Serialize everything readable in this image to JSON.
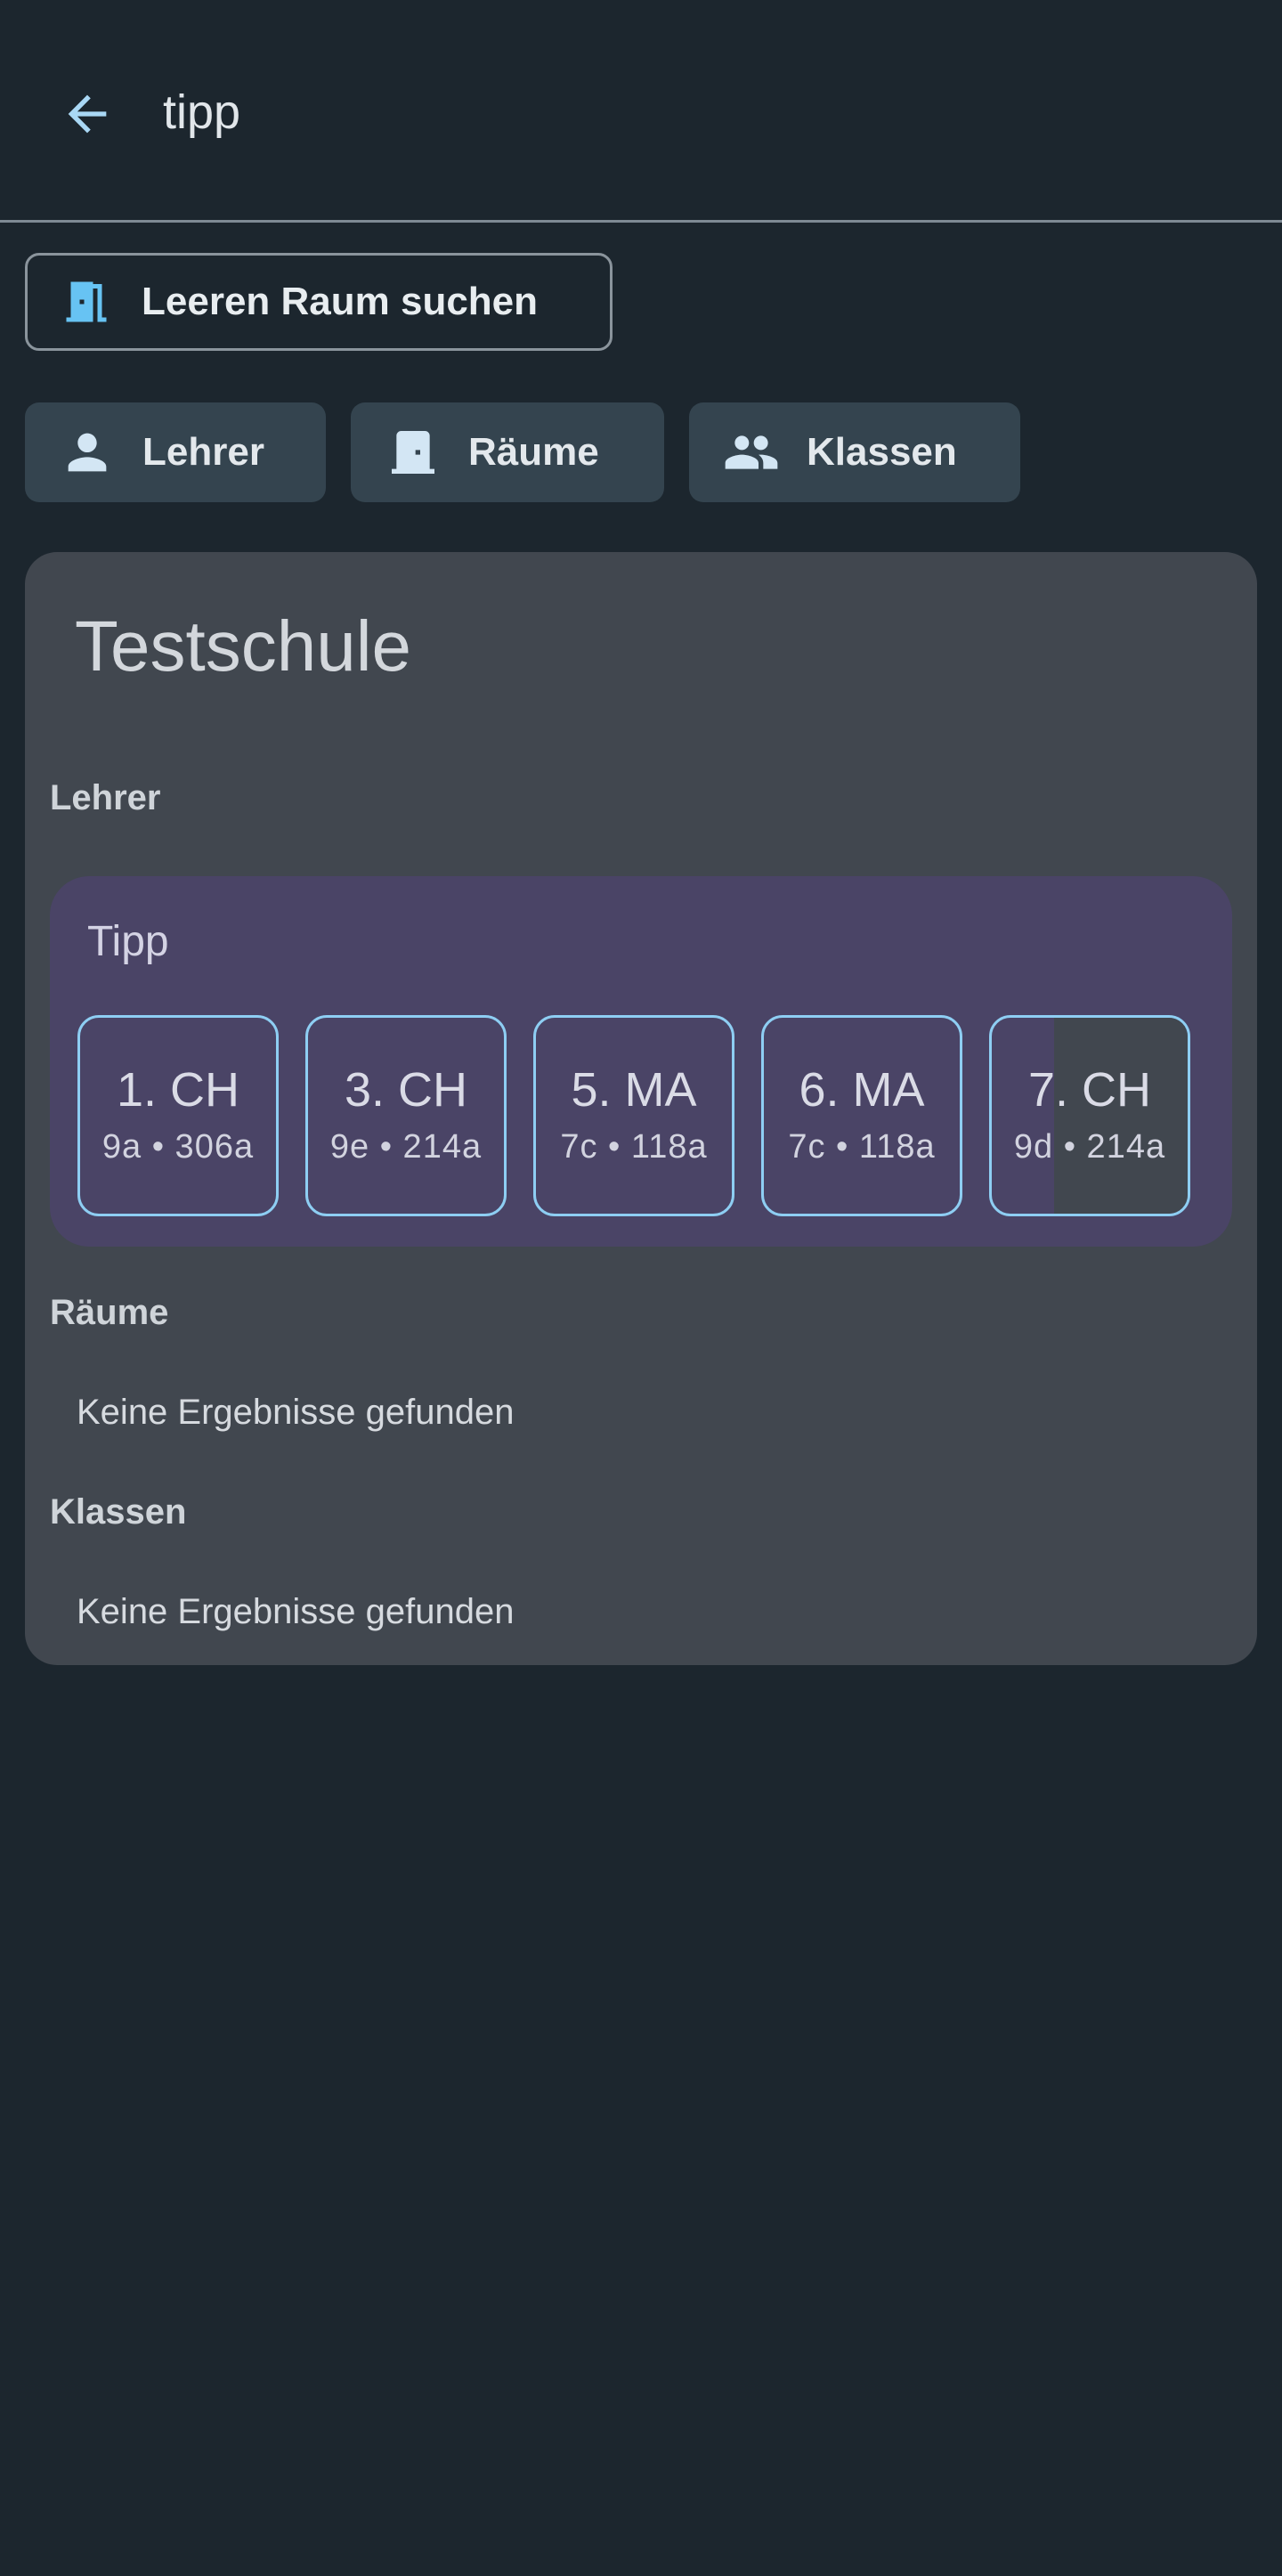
{
  "appbar": {
    "query": "tipp",
    "back_icon": "arrow-back-icon"
  },
  "empty_room_button": {
    "label": "Leeren Raum suchen",
    "icon": "door-open-icon"
  },
  "filter_chips": [
    {
      "label": "Lehrer",
      "icon": "person-icon"
    },
    {
      "label": "Räume",
      "icon": "door-icon"
    },
    {
      "label": "Klassen",
      "icon": "group-icon"
    }
  ],
  "card": {
    "title": "Testschule",
    "sections": {
      "teachers": {
        "label": "Lehrer",
        "results": [
          {
            "name": "Tipp",
            "lessons": [
              {
                "subject": "1. CH",
                "meta": "9a • 306a"
              },
              {
                "subject": "3. CH",
                "meta": "9e • 214a"
              },
              {
                "subject": "5. MA",
                "meta": "7c • 118a"
              },
              {
                "subject": "6. MA",
                "meta": "7c • 118a"
              },
              {
                "subject": "7. CH",
                "meta": "9d • 214a"
              }
            ]
          }
        ]
      },
      "rooms": {
        "label": "Räume",
        "empty_text": "Keine Ergebnisse gefunden"
      },
      "classes": {
        "label": "Klassen",
        "empty_text": "Keine Ergebnisse gefunden"
      }
    }
  },
  "colors": {
    "background": "#1c262e",
    "accent": "#8ecef3",
    "card": "#41474f",
    "result_tile": "#4a4466",
    "chip": "#34444f"
  }
}
